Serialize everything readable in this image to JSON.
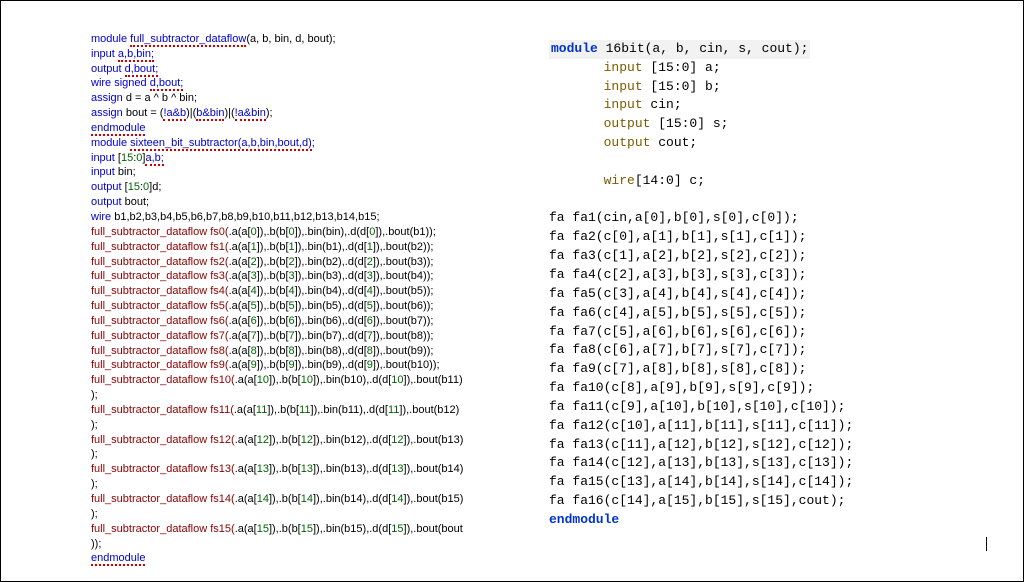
{
  "left": {
    "l1_kw": "module ",
    "l1_name": "full_subtractor_dataflow",
    "l1_tail": "(a, b, bin, d, bout);",
    "l2_kw": "input ",
    "l2_err": "a,b,bin;",
    "l3_kw": "output ",
    "l3_err": "d,bout;",
    "l4_kw": "wire signed ",
    "l4_err": "d,bout;",
    "l5_kw": "assign ",
    "l5_tail": "d = a ^ b ^ bin;",
    "l6_kw": "assign ",
    "l6_a": "bout = (",
    "l6_b": "!a&b",
    "l6_c": ")|(",
    "l6_d": "b&bin",
    "l6_e": ")|(",
    "l6_f": "!a&bin",
    "l6_g": ");",
    "l7": "endmodule",
    "l8_kw": "module ",
    "l8_name": "sixteen_bit_subtractor(a,b,bin,bout,d)",
    "l8_tail": ";",
    "l9_kw": "input ",
    "l9_a": "[",
    "l9_n1": "15",
    "l9_b": ":",
    "l9_n2": "0",
    "l9_c": "]",
    "l9_err": "a,b;",
    "l10_kw": "input ",
    "l10_tail": "bin;",
    "l11_kw": "output ",
    "l11_a": "[",
    "l11_n1": "15",
    "l11_b": ":",
    "l11_n2": "0",
    "l11_c": "]d;",
    "l12_kw": "output ",
    "l12_tail": "bout;",
    "l13_kw": "wire ",
    "l13_tail": "b1,b2,b3,b4,b5,b6,b7,b8,b9,b10,b11,b12,b13,b14,b15;",
    "fs": [
      {
        "name": "full_subtractor_dataflow fs0(",
        "aa": ".a(a[",
        "ai": "0",
        "ab": "]),.b(b[",
        "bi": "0",
        "ac": "]),.bin(bin),.d(d[",
        "di": "0",
        "ad": "]),.bout(b1));"
      },
      {
        "name": "full_subtractor_dataflow fs1(",
        "aa": ".a(a[",
        "ai": "1",
        "ab": "]),.b(b[",
        "bi": "1",
        "ac": "]),.bin(b1),.d(d[",
        "di": "1",
        "ad": "]),.bout(b2));"
      },
      {
        "name": "full_subtractor_dataflow fs2(",
        "aa": ".a(a[",
        "ai": "2",
        "ab": "]),.b(b[",
        "bi": "2",
        "ac": "]),.bin(b2),.d(d[",
        "di": "2",
        "ad": "]),.bout(b3));"
      },
      {
        "name": "full_subtractor_dataflow fs3(",
        "aa": ".a(a[",
        "ai": "3",
        "ab": "]),.b(b[",
        "bi": "3",
        "ac": "]),.bin(b3),.d(d[",
        "di": "3",
        "ad": "]),.bout(b4));"
      },
      {
        "name": "full_subtractor_dataflow fs4(",
        "aa": ".a(a[",
        "ai": "4",
        "ab": "]),.b(b[",
        "bi": "4",
        "ac": "]),.bin(b4),.d(d[",
        "di": "4",
        "ad": "]),.bout(b5));"
      },
      {
        "name": "full_subtractor_dataflow fs5(",
        "aa": ".a(a[",
        "ai": "5",
        "ab": "]),.b(b[",
        "bi": "5",
        "ac": "]),.bin(b5),.d(d[",
        "di": "5",
        "ad": "]),.bout(b6));"
      },
      {
        "name": "full_subtractor_dataflow fs6(",
        "aa": ".a(a[",
        "ai": "6",
        "ab": "]),.b(b[",
        "bi": "6",
        "ac": "]),.bin(b6),.d(d[",
        "di": "6",
        "ad": "]),.bout(b7));"
      },
      {
        "name": "full_subtractor_dataflow fs7(",
        "aa": ".a(a[",
        "ai": "7",
        "ab": "]),.b(b[",
        "bi": "7",
        "ac": "]),.bin(b7),.d(d[",
        "di": "7",
        "ad": "]),.bout(b8));"
      },
      {
        "name": "full_subtractor_dataflow fs8(",
        "aa": ".a(a[",
        "ai": "8",
        "ab": "]),.b(b[",
        "bi": "8",
        "ac": "]),.bin(b8),.d(d[",
        "di": "8",
        "ad": "]),.bout(b9));"
      },
      {
        "name": "full_subtractor_dataflow fs9(",
        "aa": ".a(a[",
        "ai": "9",
        "ab": "]),.b(b[",
        "bi": "9",
        "ac": "]),.bin(b9),.d(d[",
        "di": "9",
        "ad": "]),.bout(b10));"
      }
    ],
    "fsb": [
      {
        "name": "full_subtractor_dataflow fs10(",
        "aa": ".a(a[",
        "ai": "10",
        "ab": "]),.b(b[",
        "bi": "10",
        "ac": "]),.bin(b10),.d(d[",
        "di": "10",
        "ad": "]),.bout(b11)",
        "close": ");"
      },
      {
        "name": "full_subtractor_dataflow fs11(",
        "aa": ".a(a[",
        "ai": "11",
        "ab": "]),.b(b[",
        "bi": "11",
        "ac": "]),.bin(b11),.d(d[",
        "di": "11",
        "ad": "]),.bout(b12)",
        "close": ");"
      },
      {
        "name": "full_subtractor_dataflow fs12(",
        "aa": ".a(a[",
        "ai": "12",
        "ab": "]),.b(b[",
        "bi": "12",
        "ac": "]),.bin(b12),.d(d[",
        "di": "12",
        "ad": "]),.bout(b13)",
        "close": ");"
      },
      {
        "name": "full_subtractor_dataflow fs13(",
        "aa": ".a(a[",
        "ai": "13",
        "ab": "]),.b(b[",
        "bi": "13",
        "ac": "]),.bin(b13),.d(d[",
        "di": "13",
        "ad": "]),.bout(b14)",
        "close": ");"
      },
      {
        "name": "full_subtractor_dataflow fs14(",
        "aa": ".a(a[",
        "ai": "14",
        "ab": "]),.b(b[",
        "bi": "14",
        "ac": "]),.bin(b14),.d(d[",
        "di": "14",
        "ad": "]),.bout(b15)",
        "close": ");"
      },
      {
        "name": "full_subtractor_dataflow fs15(",
        "aa": ".a(a[",
        "ai": "15",
        "ab": "]),.b(b[",
        "bi": "15",
        "ac": "]),.bin(b15),.d(d[",
        "di": "15",
        "ad": "]),.bout(bout",
        "close": "));"
      }
    ],
    "lend": "endmodule"
  },
  "right": {
    "r1_kw": "module",
    "r1_tail": " 16bit(a, b, cin, s, cout);",
    "r2_sp": "       ",
    "r2_ty": "input",
    "r2_tail": " [15:0] a;",
    "r3_sp": "       ",
    "r3_ty": "input",
    "r3_tail": " [15:0] b;",
    "r4_sp": "       ",
    "r4_ty": "input",
    "r4_tail": " cin;",
    "r5_sp": "       ",
    "r5_ty": "output",
    "r5_tail": " [15:0] s;",
    "r6_sp": "       ",
    "r6_ty": "output",
    "r6_tail": " cout;",
    "r7_sp": "       ",
    "r7_ty": "wire",
    "r7_tail": "[14:0] c;",
    "fa": [
      "fa fa1(cin,a[0],b[0],s[0],c[0]);",
      "fa fa2(c[0],a[1],b[1],s[1],c[1]);",
      "fa fa3(c[1],a[2],b[2],s[2],c[2]);",
      "fa fa4(c[2],a[3],b[3],s[3],c[3]);",
      "fa fa5(c[3],a[4],b[4],s[4],c[4]);",
      "fa fa6(c[4],a[5],b[5],s[5],c[5]);",
      "fa fa7(c[5],a[6],b[6],s[6],c[6]);",
      "fa fa8(c[6],a[7],b[7],s[7],c[7]);",
      "fa fa9(c[7],a[8],b[8],s[8],c[8]);",
      "fa fa10(c[8],a[9],b[9],s[9],c[9]);",
      "fa fa11(c[9],a[10],b[10],s[10],c[10]);",
      "fa fa12(c[10],a[11],b[11],s[11],c[11]);",
      "fa fa13(c[11],a[12],b[12],s[12],c[12]);",
      "fa fa14(c[12],a[13],b[13],s[13],c[13]);",
      "fa fa15(c[13],a[14],b[14],s[14],c[14]);",
      "fa fa16(c[14],a[15],b[15],s[15],cout);"
    ],
    "rend": "endmodule"
  }
}
